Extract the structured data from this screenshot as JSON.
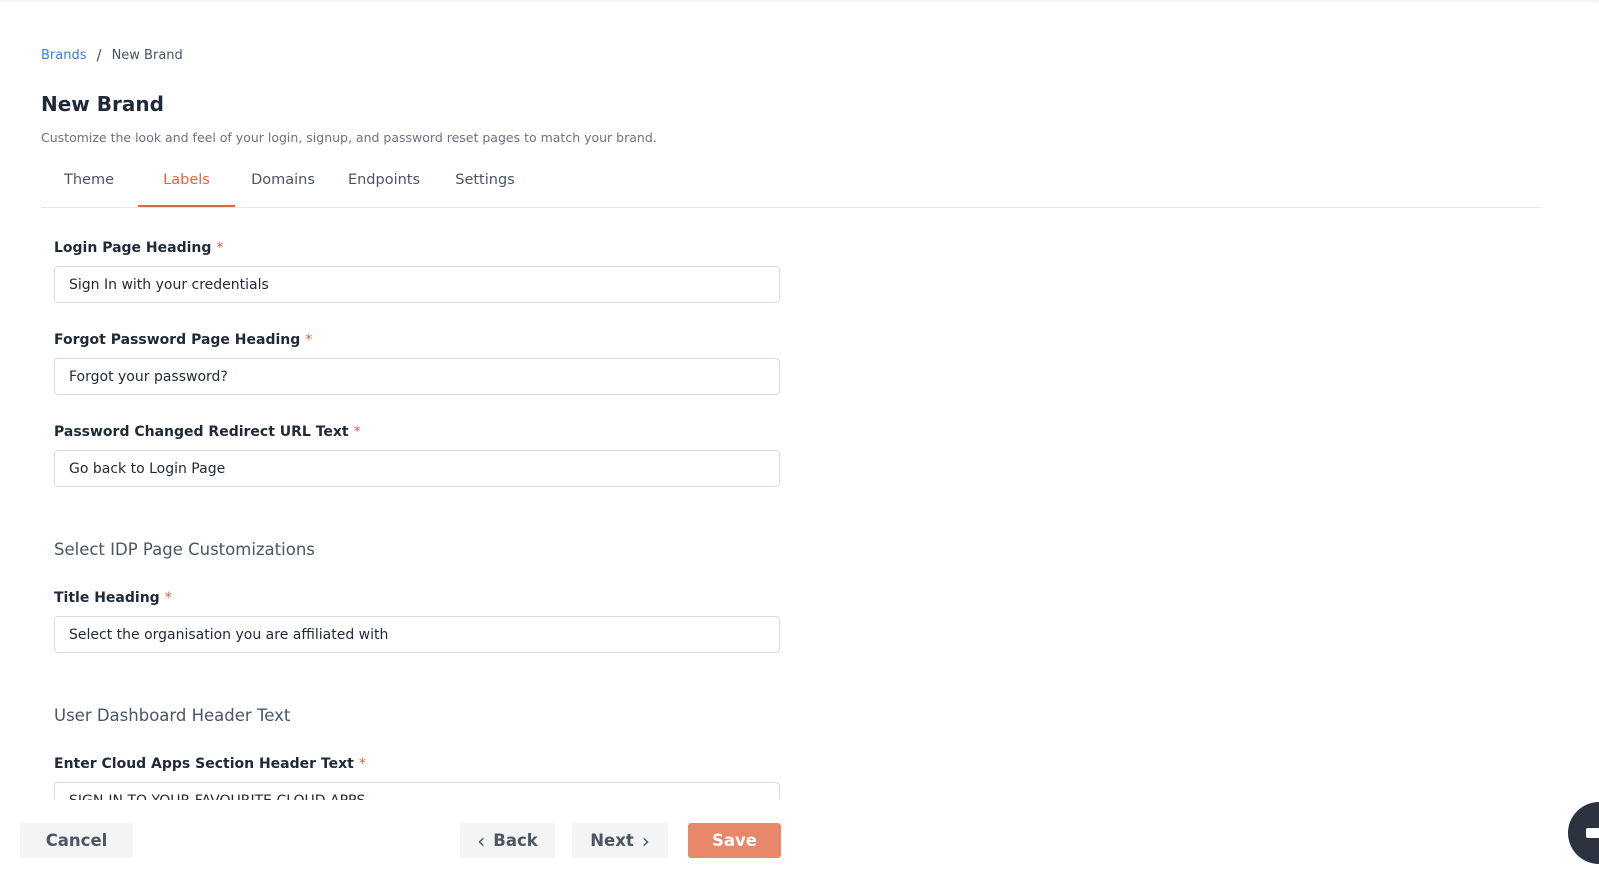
{
  "breadcrumb": {
    "parent": "Brands",
    "separator": "/",
    "current": "New Brand"
  },
  "page": {
    "title": "New Brand",
    "subtitle": "Customize the look and feel of your login, signup, and password reset pages to match your brand."
  },
  "tabs": [
    {
      "label": "Theme",
      "active": false
    },
    {
      "label": "Labels",
      "active": true
    },
    {
      "label": "Domains",
      "active": false
    },
    {
      "label": "Endpoints",
      "active": false
    },
    {
      "label": "Settings",
      "active": false
    }
  ],
  "fields": {
    "login_heading": {
      "label": "Login Page Heading",
      "required": "*",
      "value": "Sign In with your credentials"
    },
    "forgot_heading": {
      "label": "Forgot Password Page Heading",
      "required": "*",
      "value": "Forgot your password?"
    },
    "redirect_text": {
      "label": "Password Changed Redirect URL Text",
      "required": "*",
      "value": "Go back to Login Page"
    },
    "title_heading": {
      "label": "Title Heading",
      "required": "*",
      "value": "Select the organisation you are affiliated with"
    },
    "cloud_apps_header": {
      "label": "Enter Cloud Apps Section Header Text",
      "required": "*",
      "value": "SIGN-IN TO YOUR FAVOURITE CLOUD APPS"
    }
  },
  "sections": {
    "idp": "Select IDP Page Customizations",
    "dashboard": "User Dashboard Header Text"
  },
  "footer": {
    "cancel": "Cancel",
    "back": "Back",
    "next": "Next",
    "save": "Save"
  },
  "colors": {
    "accent": "#e0663f",
    "save_button": "#e8876a",
    "link": "#3b7ed8",
    "required": "#e25c4a"
  },
  "icons": {
    "back": "chevron-left-icon",
    "next": "chevron-right-icon",
    "chat": "chat-launcher-icon"
  }
}
